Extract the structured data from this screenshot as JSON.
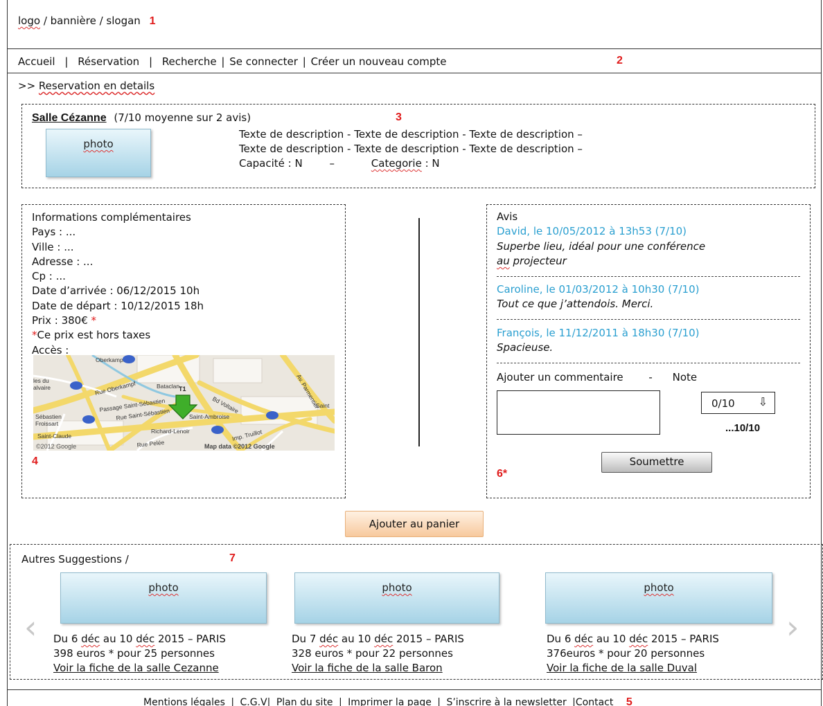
{
  "header": {
    "logo_text": "logo / bannière / slogan",
    "marker": "1"
  },
  "nav": {
    "items": [
      "Accueil",
      "Réservation",
      "Recherche",
      "Se connecter",
      "Créer un nouveau compte"
    ],
    "separators": [
      "|",
      "|",
      "|",
      "|"
    ],
    "marker": "2"
  },
  "breadcrumb": {
    "prefix": ">>",
    "text": "Reservation en details"
  },
  "room": {
    "name": "Salle Cézanne",
    "rating": "(7/10 moyenne sur 2 avis)",
    "marker": "3",
    "photo_label": "photo",
    "description_1": "Texte de description - Texte de description - Texte de description –",
    "description_2": "Texte de description - Texte de description - Texte de description –",
    "capacity": "Capacité : N",
    "dash": "–",
    "category_label": "Categorie",
    "category_value": " : N"
  },
  "info": {
    "title": "Informations complémentaires",
    "pays": "Pays : ...",
    "ville": "Ville : ...",
    "adresse": "Adresse : ...",
    "cp": "Cp : ...",
    "arrivee": "Date d’arrivée : 06/12/2015  10h",
    "depart": "Date de  départ : 10/12/2015 18h",
    "prix": "Prix : 380€",
    "asterisk": "*",
    "tax_note": "Ce prix est hors taxes",
    "acces": "Accès :",
    "marker": "4",
    "map": {
      "labels": [
        "Oberkampf",
        "Rue Oberkampf",
        "Bataclan",
        "Bd Voltaire",
        "Passage Saint-Sébastien",
        "Rue Saint-Sébastien",
        "Saint-Ambroise",
        "Richard-Lenoir",
        "Saint-Sébastien Froissart",
        "Saint-Claude",
        "Rue Pelée",
        "Imp. Truillot",
        "Av. Parmentier",
        "Saint",
        "Ind. Froissart",
        "les du Calvaire"
      ],
      "copyright_left": "©2012 Google",
      "copyright_right": "Map data ©2012 Google"
    }
  },
  "reviews": {
    "title": "Avis",
    "items": [
      {
        "author": "David, le 10/05/2012 à 13h53  (7/10)",
        "text_1": "Superbe lieu, idéal pour une conférence",
        "text_2": "au projecteur"
      },
      {
        "author": "Caroline, le 01/03/2012 à 10h30  (7/10)",
        "text_1": "Tout ce que j’attendois. Merci."
      },
      {
        "author": "François, le 11/12/2011 à 18h30  (7/10)",
        "text_1": "Spacieuse."
      }
    ],
    "add_comment": "Ajouter un commentaire",
    "dash": "-",
    "note_label": "Note",
    "note_select_value": "0/10",
    "note_max": "...10/10",
    "submit_label": "Soumettre",
    "marker": "6*"
  },
  "cart": {
    "button_label": "Ajouter au panier"
  },
  "suggestions": {
    "title": "Autres Suggestions /",
    "marker": "7",
    "items": [
      {
        "photo_label": "photo",
        "dates_prefix": "Du 6 ",
        "dec1": "déc",
        "mid": " au 10 ",
        "dec2": "déc",
        "suffix": " 2015 – PARIS",
        "price": "398 euros * pour 25 personnes",
        "link": "Voir la fiche de la salle Cezanne"
      },
      {
        "photo_label": "photo",
        "dates_prefix": "Du 7 ",
        "dec1": "déc",
        "mid": " au 10 ",
        "dec2": "déc",
        "suffix": " 2015 – PARIS",
        "price": "328 euros * pour 22 personnes",
        "link": "Voir la fiche de la salle Baron"
      },
      {
        "photo_label": "photo",
        "dates_prefix": "Du 6 ",
        "dec1": "déc",
        "mid": " au 10 ",
        "dec2": "déc",
        "suffix": " 2015 – PARIS",
        "price": "376euros * pour 20 personnes",
        "link": "Voir la fiche de la salle Duval"
      }
    ],
    "prev_arrow": "‹",
    "next_arrow": "›"
  },
  "footer": {
    "items": [
      "Mentions légales",
      "C.G.V",
      "Plan du site",
      "Imprimer la page",
      "S’inscrire à la newsletter",
      "Contact"
    ],
    "separators": [
      "|",
      "|",
      "|",
      "|",
      "|"
    ],
    "marker": "5"
  }
}
